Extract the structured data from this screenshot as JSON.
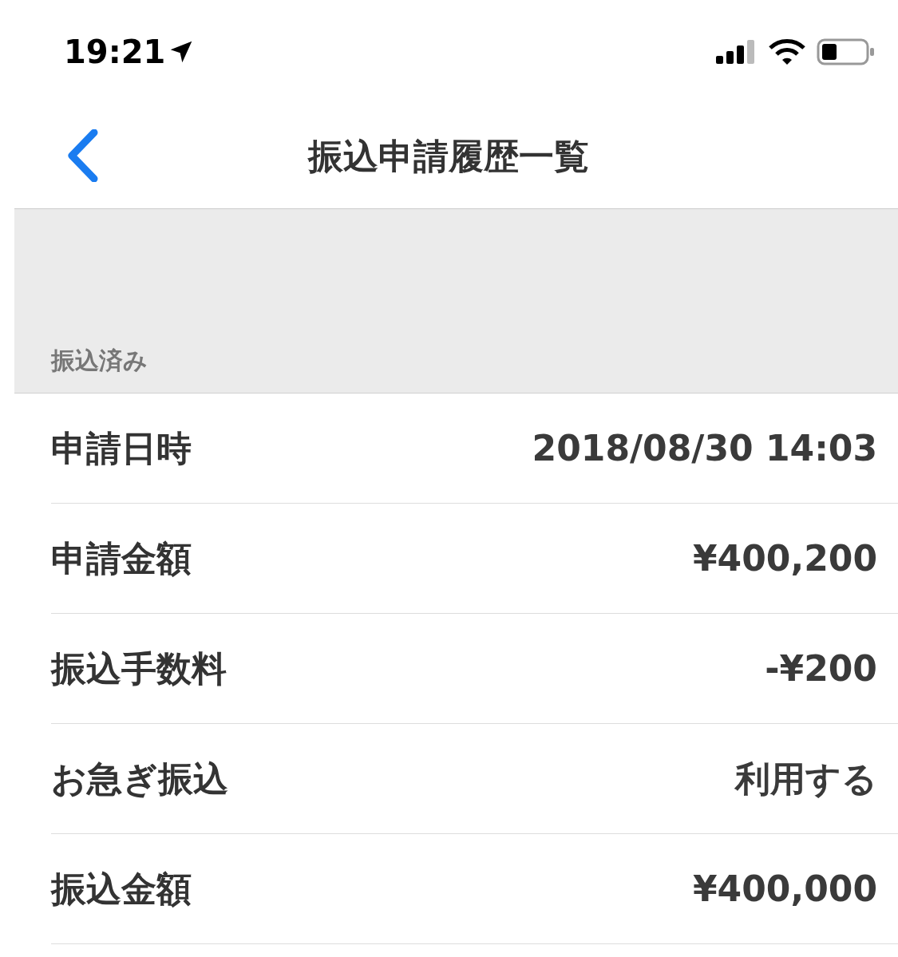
{
  "status_bar": {
    "time": "19:21"
  },
  "nav": {
    "title": "振込申請履歴一覧"
  },
  "section": {
    "header": "振込済み"
  },
  "rows": [
    {
      "label": "申請日時",
      "value": "2018/08/30 14:03"
    },
    {
      "label": "申請金額",
      "value": "¥400,200"
    },
    {
      "label": "振込手数料",
      "value": "-¥200"
    },
    {
      "label": "お急ぎ振込",
      "value": "利用する"
    },
    {
      "label": "振込金額",
      "value": "¥400,000"
    }
  ]
}
